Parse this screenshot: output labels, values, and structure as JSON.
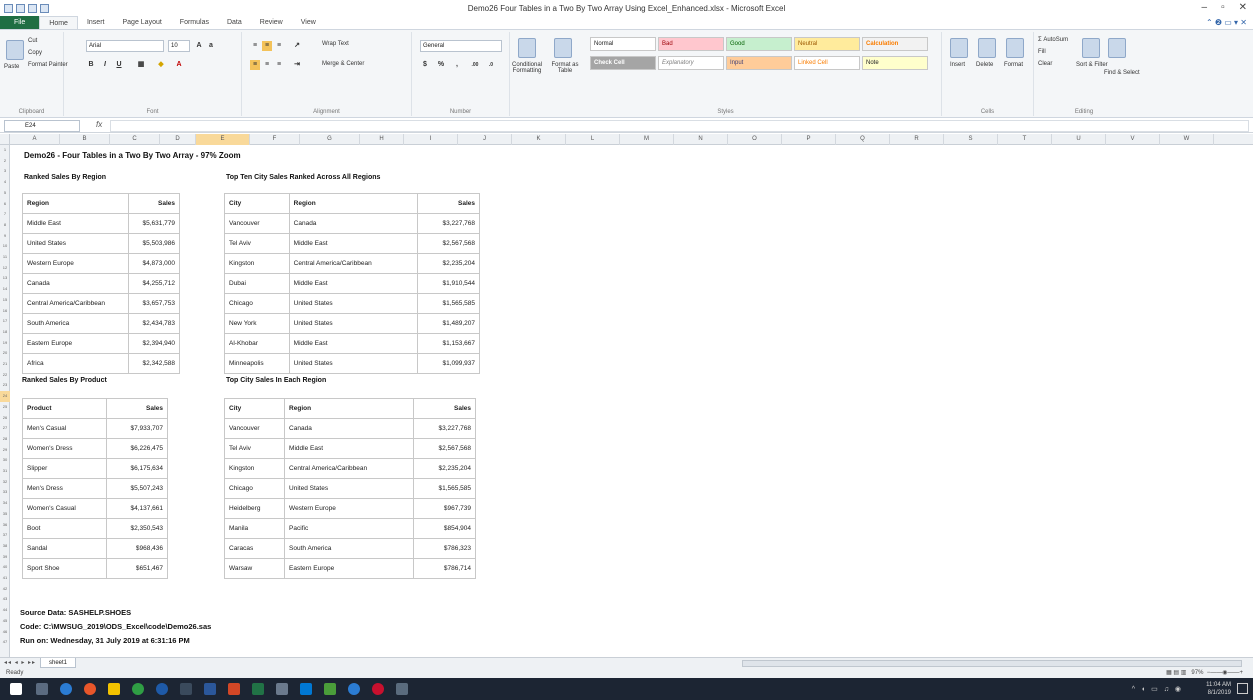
{
  "window": {
    "title": "Demo26 Four Tables in a Two By Two Array Using Excel_Enhanced.xlsx - Microsoft Excel"
  },
  "ribbon_tabs": [
    "File",
    "Home",
    "Insert",
    "Page Layout",
    "Formulas",
    "Data",
    "Review",
    "View"
  ],
  "ribbon": {
    "clipboard": {
      "cut": "Cut",
      "copy": "Copy",
      "format_painter": "Format Painter",
      "paste": "Paste",
      "label": "Clipboard"
    },
    "font": {
      "name": "Arial",
      "size": "10",
      "label": "Font"
    },
    "alignment": {
      "wrap": "Wrap Text",
      "merge": "Merge & Center",
      "label": "Alignment"
    },
    "number": {
      "format": "General",
      "label": "Number"
    },
    "styles": {
      "conditional": "Conditional Formatting",
      "format_table": "Format as Table",
      "items": [
        "Normal",
        "Bad",
        "Good",
        "Neutral",
        "Calculation",
        "Check Cell",
        "Explanatory",
        "Input",
        "Linked Cell",
        "Note"
      ],
      "label": "Styles"
    },
    "cells": {
      "insert": "Insert",
      "delete": "Delete",
      "format": "Format",
      "label": "Cells"
    },
    "editing": {
      "autosum": "AutoSum",
      "fill": "Fill",
      "clear": "Clear",
      "sort": "Sort & Filter",
      "find": "Find & Select",
      "label": "Editing"
    }
  },
  "formula_bar": {
    "name_box": "E24",
    "fx": "fx",
    "content": ""
  },
  "columns": [
    "A",
    "B",
    "C",
    "D",
    "E",
    "F",
    "G",
    "H",
    "I",
    "J",
    "K",
    "L",
    "M",
    "N",
    "O",
    "P",
    "Q",
    "R",
    "S",
    "T",
    "U",
    "V",
    "W"
  ],
  "selected_column": "E",
  "selected_row": "24",
  "sheet_title": "Demo26 - Four Tables in a Two By Two Array - 97% Zoom",
  "table1": {
    "title": "Ranked Sales By Region",
    "headers": [
      "Region",
      "Sales"
    ],
    "rows": [
      [
        "Middle East",
        "$5,631,779"
      ],
      [
        "United States",
        "$5,503,986"
      ],
      [
        "Western Europe",
        "$4,873,000"
      ],
      [
        "Canada",
        "$4,255,712"
      ],
      [
        "Central America/Caribbean",
        "$3,657,753"
      ],
      [
        "South America",
        "$2,434,783"
      ],
      [
        "Eastern Europe",
        "$2,394,940"
      ],
      [
        "Africa",
        "$2,342,588"
      ]
    ]
  },
  "table2": {
    "title": "Top Ten City Sales Ranked Across All Regions",
    "headers": [
      "City",
      "Region",
      "Sales"
    ],
    "rows": [
      [
        "Vancouver",
        "Canada",
        "$3,227,768"
      ],
      [
        "Tel Aviv",
        "Middle East",
        "$2,567,568"
      ],
      [
        "Kingston",
        "Central America/Caribbean",
        "$2,235,204"
      ],
      [
        "Dubai",
        "Middle East",
        "$1,910,544"
      ],
      [
        "Chicago",
        "United States",
        "$1,565,585"
      ],
      [
        "New York",
        "United States",
        "$1,489,207"
      ],
      [
        "Al-Khobar",
        "Middle East",
        "$1,153,667"
      ],
      [
        "Minneapolis",
        "United States",
        "$1,099,937"
      ]
    ]
  },
  "table3": {
    "title": "Ranked Sales By Product",
    "headers": [
      "Product",
      "Sales"
    ],
    "rows": [
      [
        "Men's Casual",
        "$7,933,707"
      ],
      [
        "Women's Dress",
        "$6,226,475"
      ],
      [
        "Slipper",
        "$6,175,634"
      ],
      [
        "Men's Dress",
        "$5,507,243"
      ],
      [
        "Women's Casual",
        "$4,137,661"
      ],
      [
        "Boot",
        "$2,350,543"
      ],
      [
        "Sandal",
        "$968,436"
      ],
      [
        "Sport Shoe",
        "$651,467"
      ]
    ]
  },
  "table4": {
    "title": "Top City Sales In Each Region",
    "headers": [
      "City",
      "Region",
      "Sales"
    ],
    "rows": [
      [
        "Vancouver",
        "Canada",
        "$3,227,768"
      ],
      [
        "Tel Aviv",
        "Middle East",
        "$2,567,568"
      ],
      [
        "Kingston",
        "Central America/Caribbean",
        "$2,235,204"
      ],
      [
        "Chicago",
        "United States",
        "$1,565,585"
      ],
      [
        "Heidelberg",
        "Western Europe",
        "$967,739"
      ],
      [
        "Manila",
        "Pacific",
        "$854,904"
      ],
      [
        "Caracas",
        "South America",
        "$786,323"
      ],
      [
        "Warsaw",
        "Eastern Europe",
        "$786,714"
      ]
    ]
  },
  "footer": {
    "source": "Source Data: SASHELP.SHOES",
    "code": "Code: C:\\MWSUG_2019\\ODS_Excel\\code\\Demo26.sas",
    "run": "Run on: Wednesday, 31 July 2019 at 6:31:16 PM"
  },
  "sheet_tab": "sheet1",
  "status": "Ready",
  "zoom": "97%",
  "clock": {
    "time": "11:04 AM",
    "date": "8/1/2019"
  }
}
